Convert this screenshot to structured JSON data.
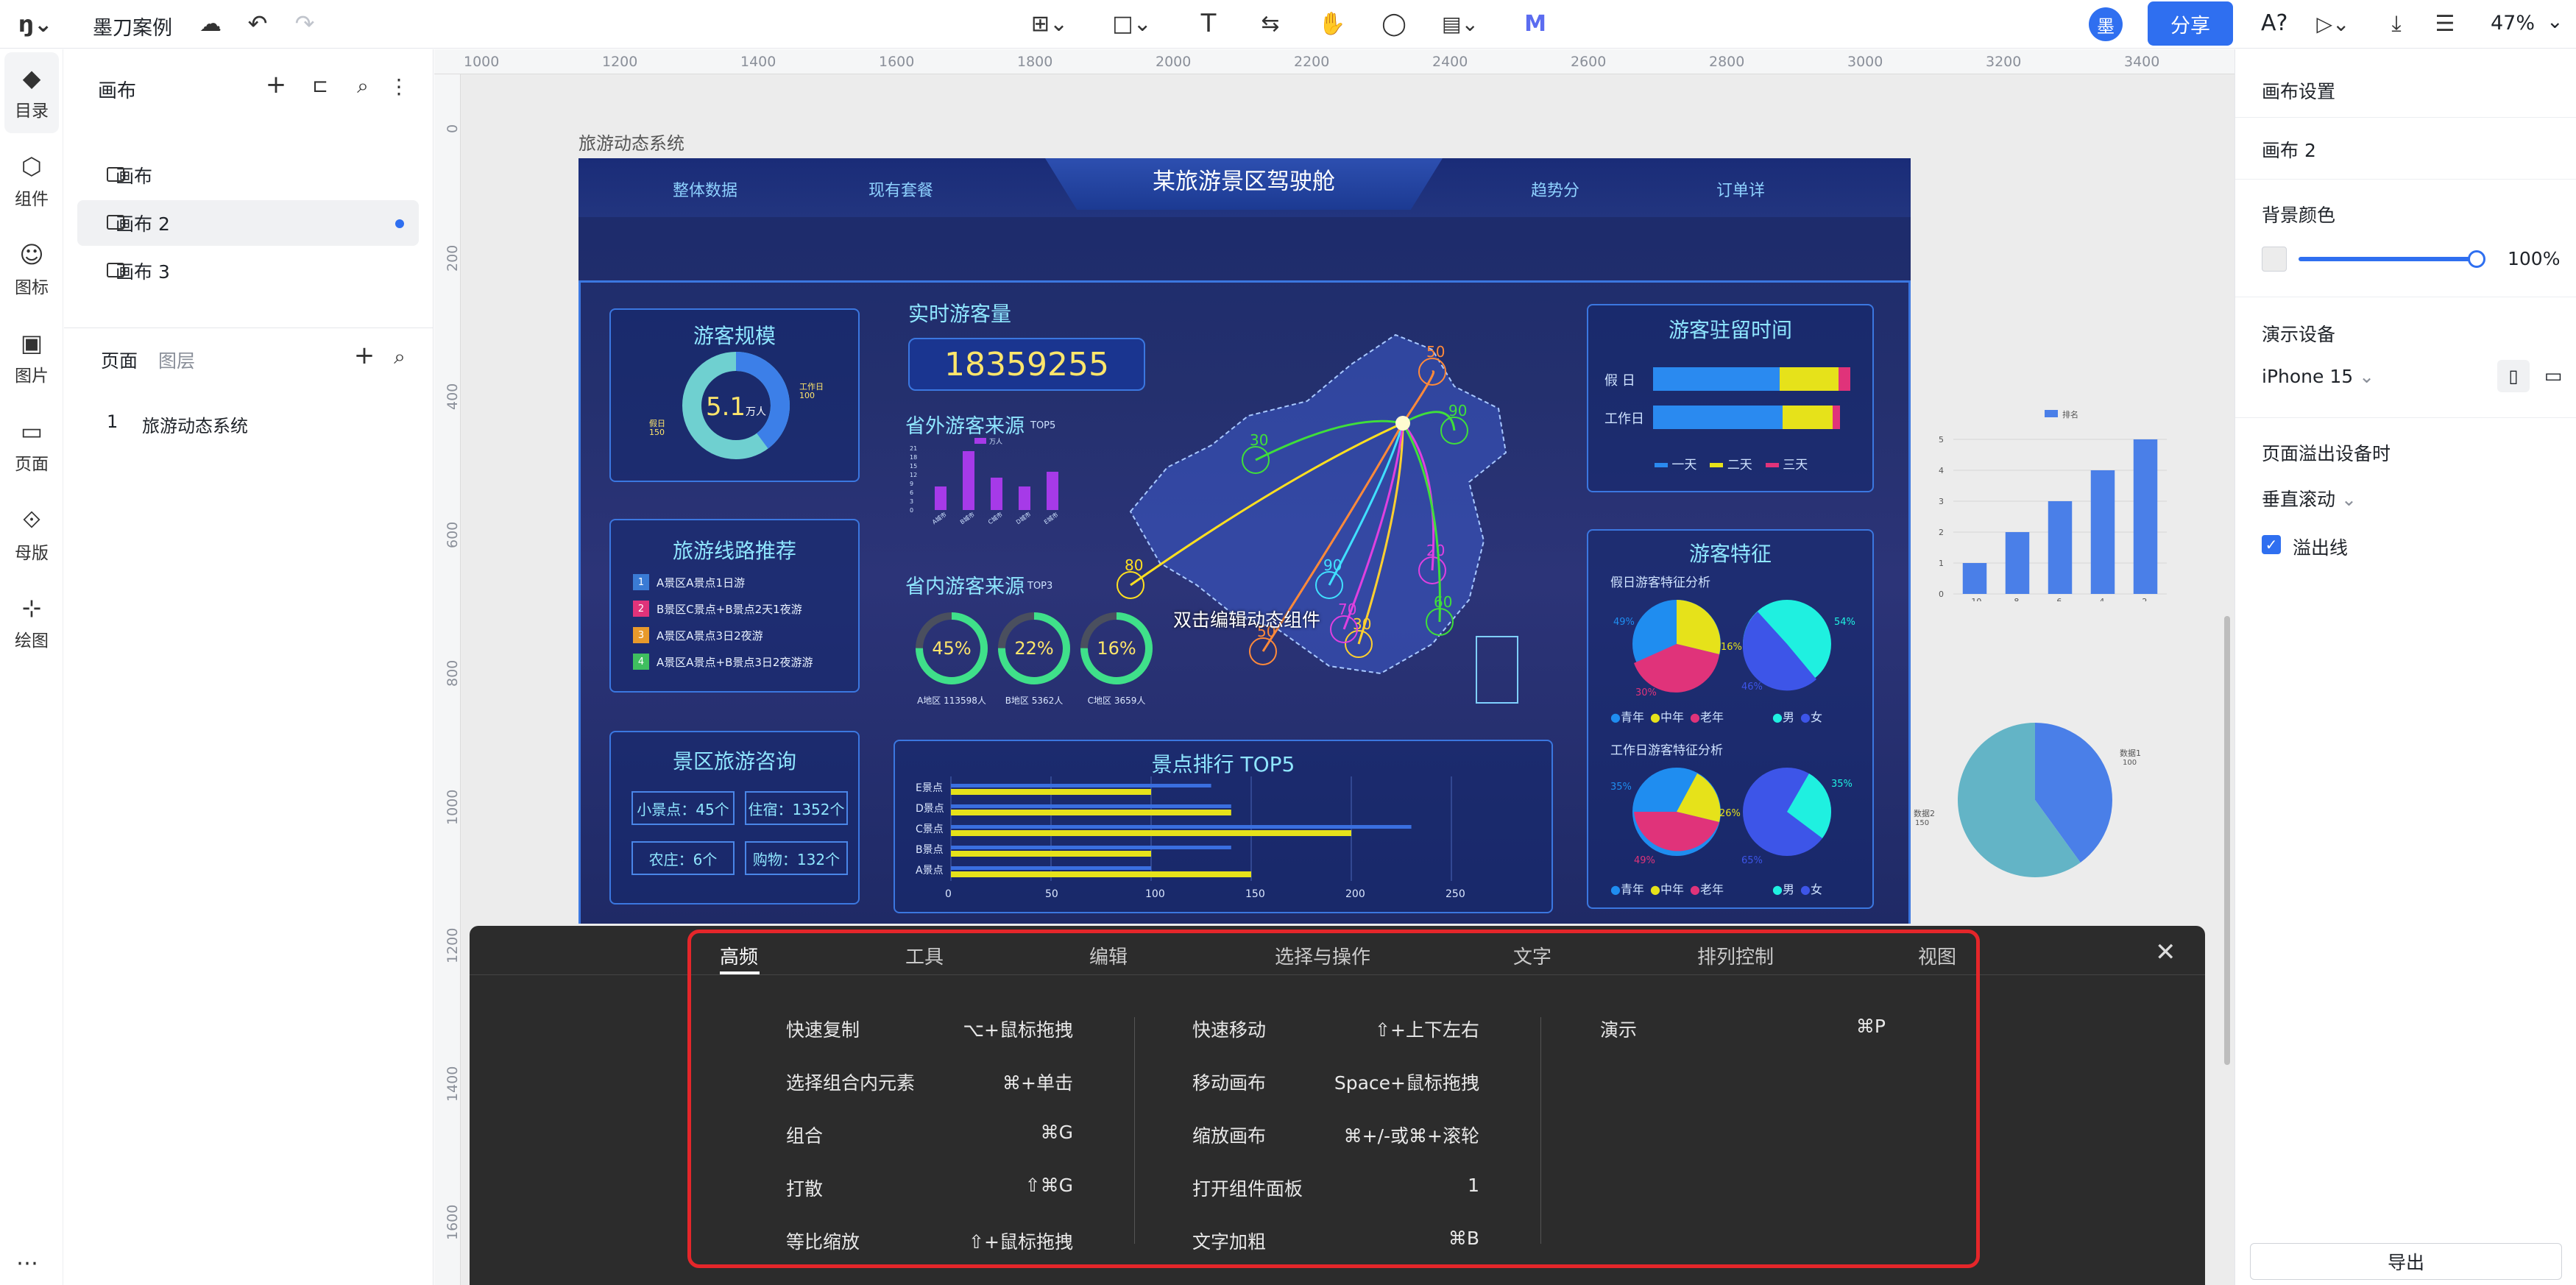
{
  "topbar": {
    "project_name": "墨刀案例",
    "zoom": "47%",
    "share_label": "分享",
    "avatar_text": "墨",
    "font_tool": "A?"
  },
  "rail": {
    "items": [
      {
        "label": "目录",
        "icon": "layers-icon"
      },
      {
        "label": "组件",
        "icon": "cube-icon"
      },
      {
        "label": "图标",
        "icon": "smile-icon"
      },
      {
        "label": "图片",
        "icon": "image-icon"
      },
      {
        "label": "页面",
        "icon": "bookmark-icon"
      },
      {
        "label": "母版",
        "icon": "master-icon"
      },
      {
        "label": "绘图",
        "icon": "draw-icon"
      }
    ]
  },
  "left_panel": {
    "header": "画布",
    "canvases": [
      "画布",
      "画布 2",
      "画布 3"
    ],
    "tabs": {
      "pages": "页面",
      "layers": "图层"
    },
    "pages": [
      {
        "index": "1",
        "name": "旅游动态系统"
      }
    ]
  },
  "ruler": {
    "top": [
      "1000",
      "1200",
      "1400",
      "1600",
      "1800",
      "2000",
      "2200",
      "2400",
      "2600",
      "2800",
      "3000",
      "3200",
      "3400"
    ],
    "left": [
      "0",
      "200",
      "400",
      "600",
      "800",
      "1000",
      "1200",
      "1400",
      "1600"
    ]
  },
  "frame_label": "旅游动态系统",
  "dashboard": {
    "title": "某旅游景区驾驶舱",
    "nav": [
      "整体数据",
      "现有套餐",
      "趋势分",
      "订单详"
    ],
    "scale": {
      "title": "游客规模",
      "value": "5.1",
      "unit": "万人",
      "holiday": "假日",
      "holiday_v": "150",
      "workday": "工作日",
      "workday_v": "100"
    },
    "routes": {
      "title": "旅游线路推荐",
      "items": [
        {
          "n": "1",
          "t": "A景区A景点1日游",
          "c": "#3a7bd5"
        },
        {
          "n": "2",
          "t": "B景区C景点+B景点2天1夜游",
          "c": "#e0337a"
        },
        {
          "n": "3",
          "t": "A景区A景点3日2夜游",
          "c": "#e89a2c"
        },
        {
          "n": "4",
          "t": "A景区A景点+B景点3日2夜游游",
          "c": "#3fbf5f"
        }
      ]
    },
    "consult": {
      "title": "景区旅游咨询",
      "cells": [
        "小景点：45个",
        "住宿：1352个",
        "农庄：6个",
        "购物：132个"
      ]
    },
    "realtime": {
      "title": "实时游客量",
      "value": "18359255"
    },
    "abroad": {
      "title": "省外游客来源",
      "tag": "TOP5",
      "legend": "万人",
      "yticks": [
        "21",
        "18",
        "15",
        "12",
        "9",
        "6",
        "3",
        "0"
      ],
      "cats": [
        "A城市",
        "B城市",
        "C城市",
        "D城市",
        "E城市"
      ],
      "values": [
        8,
        20,
        11,
        8,
        13
      ]
    },
    "province": {
      "title": "省内游客来源",
      "tag": "TOP3",
      "rings": [
        {
          "pct": "45%",
          "label": "A地区 113598人"
        },
        {
          "pct": "22%",
          "label": "B地区 5362人"
        },
        {
          "pct": "16%",
          "label": "C地区 3659人"
        }
      ]
    },
    "map_hint": "双击编辑动态组件",
    "map_labels": [
      "50",
      "30",
      "90",
      "80",
      "90",
      "20",
      "60",
      "30",
      "50",
      "70"
    ],
    "stay": {
      "title": "游客驻留时间",
      "rows": [
        "假 日",
        "工作日"
      ],
      "legend": [
        "一天",
        "二天",
        "三天"
      ]
    },
    "features": {
      "title": "游客特征",
      "sub1": "假日游客特征分析",
      "sub2": "工作日游客特征分析",
      "legend_age": [
        "青年",
        "中年",
        "老年"
      ],
      "legend_sex": [
        "男",
        "女"
      ],
      "p1": [
        "49%",
        "16%",
        "30%"
      ],
      "p2": [
        "54%",
        "46%"
      ],
      "p3": [
        "35%",
        "26%",
        "49%"
      ],
      "p4": [
        "35%",
        "65%"
      ]
    },
    "ranking": {
      "title": "景点排行  TOP5",
      "cats": [
        "E景点",
        "D景点",
        "C景点",
        "B景点",
        "A景点"
      ],
      "xticks": [
        "0",
        "50",
        "100",
        "150",
        "200",
        "250"
      ]
    }
  },
  "side_bar_chart": {
    "type": "bar",
    "legend": "排名",
    "categories": [
      "10",
      "8",
      "6",
      "4",
      "2"
    ],
    "values": [
      1,
      2,
      3,
      4,
      5
    ],
    "yticks": [
      "5",
      "4",
      "3",
      "2",
      "1",
      "0"
    ],
    "ylim": [
      0,
      5
    ]
  },
  "side_pie_chart": {
    "type": "pie",
    "labels": [
      "数据1",
      "数据2"
    ],
    "values": [
      100,
      150
    ]
  },
  "right_panel": {
    "canvas_settings": "画布设置",
    "canvas_name": "画布 2",
    "bg_color": "背景颜色",
    "opacity": "100%",
    "device_label": "演示设备",
    "device": "iPhone 15",
    "overflow_label": "页面溢出设备时",
    "overflow_mode": "垂直滚动",
    "overflow_line": "溢出线",
    "export": "导出"
  },
  "shortcuts": {
    "tabs": [
      "高频",
      "工具",
      "编辑",
      "选择与操作",
      "文字",
      "排列控制",
      "视图"
    ],
    "col1": [
      [
        "快速复制",
        "⌥+鼠标拖拽"
      ],
      [
        "选择组合内元素",
        "⌘+单击"
      ],
      [
        "组合",
        "⌘G"
      ],
      [
        "打散",
        "⇧⌘G"
      ],
      [
        "等比缩放",
        "⇧+鼠标拖拽"
      ]
    ],
    "col2": [
      [
        "快速移动",
        "⇧+上下左右"
      ],
      [
        "移动画布",
        "Space+鼠标拖拽"
      ],
      [
        "缩放画布",
        "⌘+/-或⌘+滚轮"
      ],
      [
        "打开组件面板",
        "1"
      ],
      [
        "文字加粗",
        "⌘B"
      ]
    ],
    "col3": [
      [
        "演示",
        "⌘P"
      ]
    ]
  }
}
